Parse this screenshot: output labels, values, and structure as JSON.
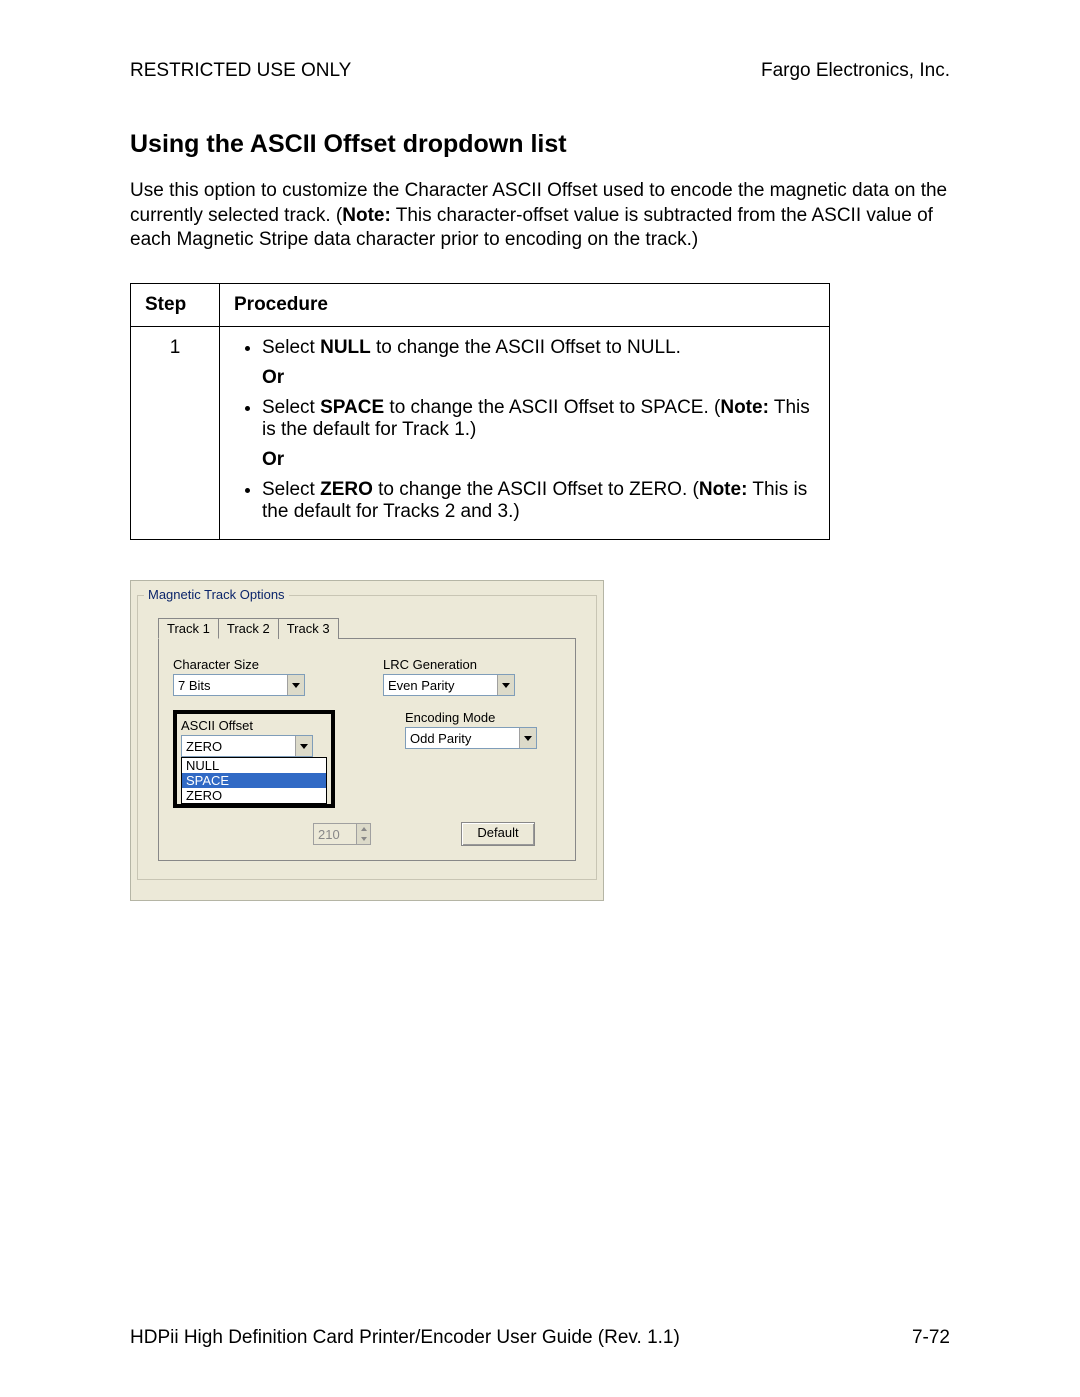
{
  "header": {
    "left": "RESTRICTED USE ONLY",
    "right": "Fargo Electronics, Inc."
  },
  "title": "Using the ASCII Offset dropdown list",
  "intro": {
    "text1": "Use this option to customize the Character ASCII Offset used to encode the magnetic data on the currently selected track. (",
    "note_label": "Note:",
    "text2": "  This character-offset value is subtracted from the ASCII value of each Magnetic Stripe data character prior to encoding on the track.)"
  },
  "table": {
    "headers": {
      "step": "Step",
      "procedure": "Procedure"
    },
    "step": "1",
    "items": [
      {
        "pre": "Select ",
        "b": "NULL",
        "post": " to change the ASCII Offset to NULL."
      },
      {
        "pre": "Select ",
        "b": "SPACE",
        "post": " to change the ASCII Offset to SPACE. (",
        "note": "Note:",
        "post2": "  This is the default for Track 1.)"
      },
      {
        "pre": "Select ",
        "b": "ZERO",
        "post": " to change the ASCII Offset to ZERO. (",
        "note": "Note:",
        "post2": "  This is the default for Tracks 2 and 3.)"
      }
    ],
    "or": "Or"
  },
  "dialog": {
    "legendLabel": "Magnetic Track Options",
    "tabs": [
      "Track 1",
      "Track 2",
      "Track 3"
    ],
    "charSize": {
      "label": "Character Size",
      "value": "7 Bits"
    },
    "lrc": {
      "label": "LRC Generation",
      "value": "Even Parity"
    },
    "asciiOffset": {
      "label": "ASCII Offset",
      "value": "ZERO",
      "options": [
        "NULL",
        "SPACE",
        "ZERO"
      ],
      "selectedIndex": 1
    },
    "encoding": {
      "label": "Encoding Mode",
      "value": "Odd Parity"
    },
    "spinnerValue": "210",
    "defaultBtn": "Default"
  },
  "footer": {
    "left": "HDPii High Definition Card Printer/Encoder User Guide (Rev. 1.1)",
    "right": "7-72"
  }
}
